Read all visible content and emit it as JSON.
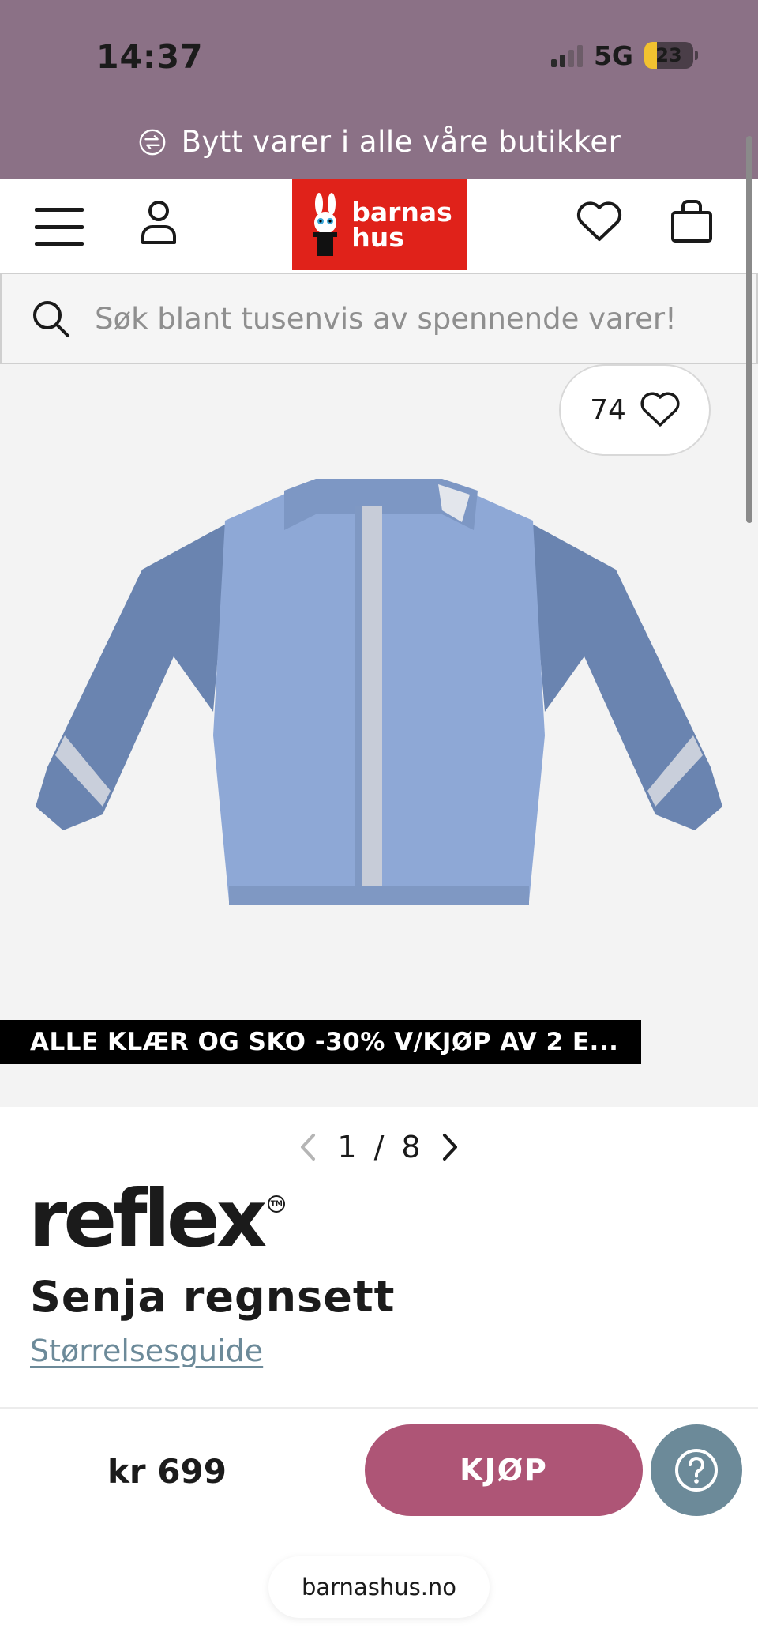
{
  "status_bar": {
    "time": "14:37",
    "network": "5G",
    "battery": "23"
  },
  "promo": {
    "text": "Bytt varer i alle våre butikker",
    "icon": "exchange-icon"
  },
  "header": {
    "logo_line1": "barnas",
    "logo_line2": "hus",
    "icons": [
      "menu-icon",
      "user-icon",
      "heart-icon",
      "shopping-bag-icon"
    ]
  },
  "search": {
    "placeholder": "Søk blant tusenvis av spennende varer!"
  },
  "gallery": {
    "favorites_count": "74",
    "sale_banner": "ALLE KLÆR OG SKO -30% V/KJØP AV 2 E...",
    "pager_current": "1",
    "pager_separator": "/",
    "pager_total": "8"
  },
  "product": {
    "brand": "reflex",
    "brand_tm": "TM",
    "title": "Senja regnsett",
    "size_guide": "Størrelsesguide",
    "price": "kr 699",
    "buy_label": "KJØP"
  },
  "browser": {
    "url": "barnashus.no"
  },
  "colors": {
    "topbar": "#8b7186",
    "logo_red": "#e0221a",
    "buy_button": "#ae5576",
    "help_button": "#6c8a99",
    "link": "#6c8a99"
  }
}
